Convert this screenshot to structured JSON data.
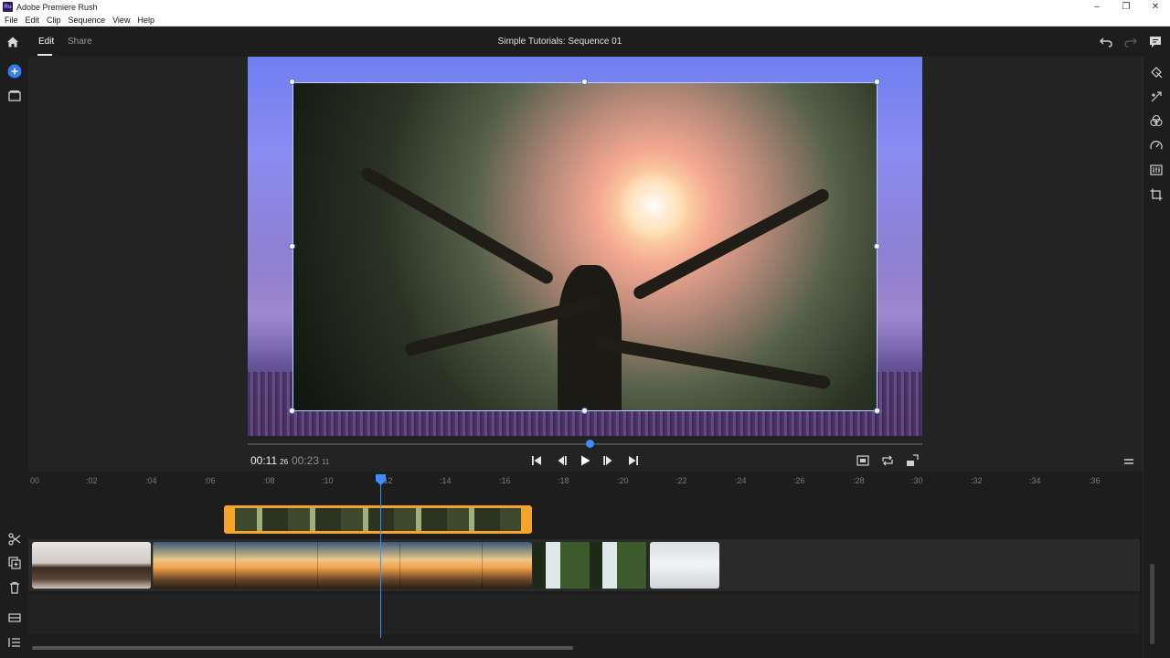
{
  "window": {
    "title": "Adobe Premiere Rush",
    "app_icon": "Ru"
  },
  "menu": [
    "File",
    "Edit",
    "Clip",
    "Sequence",
    "View",
    "Help"
  ],
  "tabs": {
    "edit": "Edit",
    "share": "Share"
  },
  "sequence_title": "Simple Tutorials: Sequence 01",
  "player": {
    "timecode_current": "00:11",
    "timecode_current_frames": "26",
    "timecode_total": "00:23",
    "timecode_total_frames": "11",
    "scrubber_position": 0.507
  },
  "ruler_labels": [
    "00",
    ":02",
    ":04",
    ":06",
    ":08",
    ":10",
    ":12",
    ":14",
    ":16",
    ":18",
    ":20",
    ":22",
    ":24",
    ":26",
    ":28",
    ":30",
    ":32",
    ":34",
    ":36"
  ],
  "colors": {
    "accent": "#3d8bff",
    "selection": "#f7a52a",
    "background": "#1d1d1d"
  },
  "icons": {
    "left_rail": [
      "add-media-icon",
      "project-media-icon",
      "split-icon",
      "duplicate-icon",
      "delete-icon",
      "track-toggle-icon",
      "track-list-icon"
    ],
    "right_rail": [
      "transform-icon",
      "effects-icon",
      "color-icon",
      "speed-icon",
      "audio-icon",
      "crop-icon"
    ],
    "transport": [
      "skip-to-start-icon",
      "step-back-icon",
      "play-icon",
      "step-forward-icon",
      "skip-to-end-icon"
    ]
  }
}
